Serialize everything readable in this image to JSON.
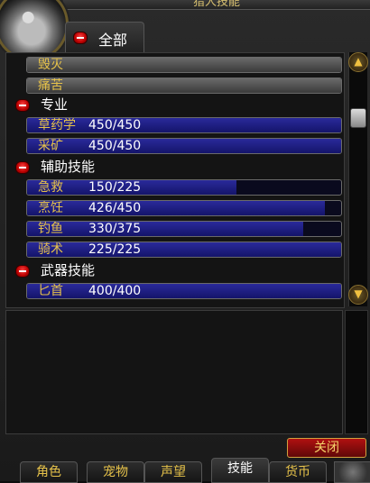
{
  "window": {
    "title": "猎人技能"
  },
  "category_tab": {
    "label": "全部"
  },
  "rows": [
    {
      "kind": "gray",
      "name": "毁灭"
    },
    {
      "kind": "gray",
      "name": "痛苦"
    },
    {
      "kind": "header",
      "name": "专业"
    },
    {
      "kind": "skill",
      "name": "草药学",
      "value": "450/450",
      "fill": 1.0
    },
    {
      "kind": "skill",
      "name": "采矿",
      "value": "450/450",
      "fill": 1.0
    },
    {
      "kind": "header",
      "name": "辅助技能"
    },
    {
      "kind": "skill",
      "name": "急救",
      "value": "150/225",
      "fill": 0.667
    },
    {
      "kind": "skill",
      "name": "烹饪",
      "value": "426/450",
      "fill": 0.947
    },
    {
      "kind": "skill",
      "name": "钓鱼",
      "value": "330/375",
      "fill": 0.88
    },
    {
      "kind": "skill",
      "name": "骑术",
      "value": "225/225",
      "fill": 1.0
    },
    {
      "kind": "header",
      "name": "武器技能"
    },
    {
      "kind": "skill",
      "name": "匕首",
      "value": "400/400",
      "fill": 1.0
    }
  ],
  "close_button": {
    "label": "关闭"
  },
  "bottom_tabs": [
    "角色",
    "宠物",
    "声望",
    "技能",
    "货币"
  ],
  "active_tab": "技能",
  "colors": {
    "skill_fill": "#1e1e86",
    "label_gold": "#e6c24a",
    "close_red": "#b01010"
  }
}
